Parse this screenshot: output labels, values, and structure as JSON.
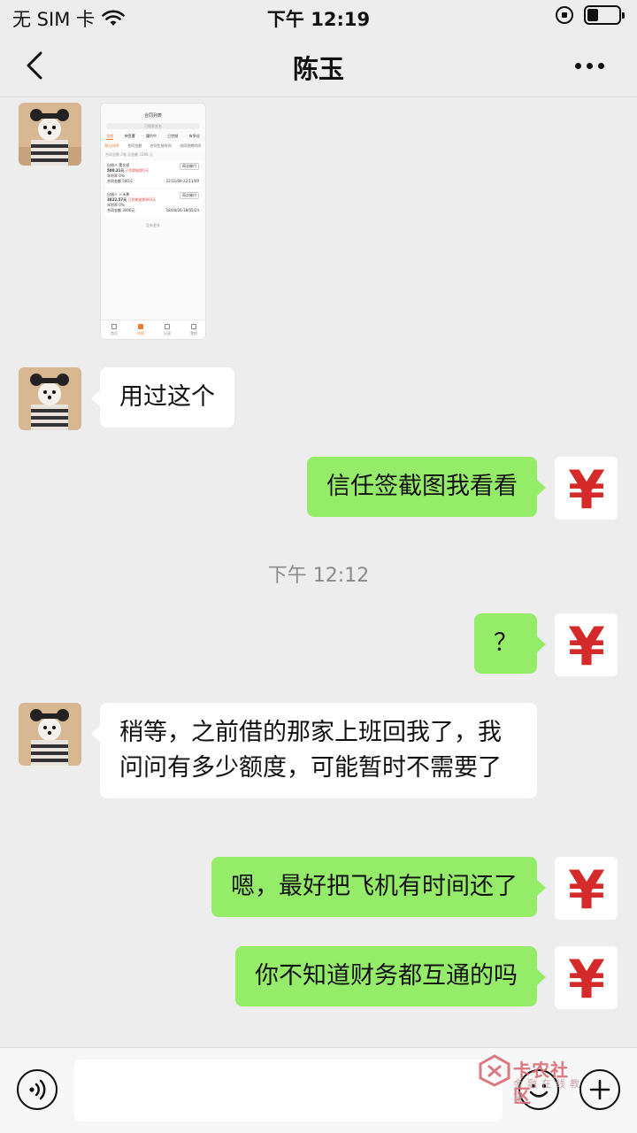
{
  "status_bar": {
    "carrier": "无 SIM 卡",
    "time": "下午 12:19"
  },
  "header": {
    "title": "陈玉"
  },
  "screenshot": {
    "title": "合同列表",
    "search_placeholder": "可搜索姓名",
    "tabs": [
      "全部",
      "待签署",
      "履约中",
      "已完结",
      "有争议"
    ],
    "filters": [
      "默认排序",
      "合同金额",
      "合同生效时间",
      "合同到期时间"
    ],
    "count": "合同总数 2笔 总金额 3368 元",
    "cards": [
      {
        "party_label": "出借人",
        "party": "董文斌",
        "button": "再次催付",
        "amount": "500.21元",
        "overdue": "已到期逾期1天",
        "rate": "年利率 0%",
        "principal": "合同金额 500元",
        "dates": "22/11/09-22/11/09"
      },
      {
        "party_label": "出借人",
        "party": "卜永勇",
        "button": "再次催付",
        "amount": "3822.57元",
        "overdue": "已到期逾期893天",
        "rate": "年利率 0%",
        "principal": "合同金额 3000元",
        "dates": "18/04/26-18/05/24"
      }
    ],
    "no_more": "没有更多",
    "tabbar": [
      "首页",
      "合同",
      "记录",
      "我的"
    ]
  },
  "messages": [
    {
      "side": "left",
      "text": "用过这个"
    },
    {
      "side": "right",
      "text": "信任签截图我看看"
    },
    {
      "side": "right",
      "text": "？"
    },
    {
      "side": "left",
      "text": "稍等，之前借的那家上班回我了，我问问有多少额度，可能暂时不需要了"
    },
    {
      "side": "right",
      "text": "嗯，最好把飞机有时间还了"
    },
    {
      "side": "right",
      "text": "你不知道财务都互通的吗"
    }
  ],
  "timestamp": "下午 12:12",
  "input": {
    "value": ""
  },
  "watermark": {
    "title": "卡农社区",
    "subtitle": "金融在线教育"
  },
  "colors": {
    "background": "#ededed",
    "bubble_self": "#95ec69",
    "bubble_other": "#ffffff",
    "accent": "#f07b2a",
    "yen": "#d42a2a"
  }
}
